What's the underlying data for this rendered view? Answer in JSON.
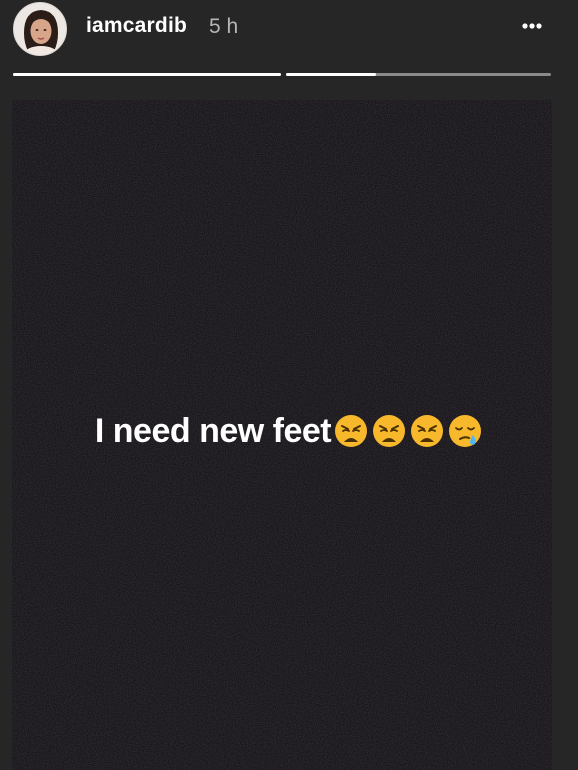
{
  "story": {
    "username": "iamcardib",
    "timestamp": "5 h",
    "caption_text": "I need new feet",
    "caption_emojis": [
      "weary-face-emoji",
      "weary-face-emoji",
      "weary-face-emoji",
      "sleepy-face-emoji"
    ],
    "progress": [
      1.0,
      0.34
    ]
  },
  "icons": {
    "more": "more-options-icon",
    "avatar": "profile-avatar"
  },
  "colors": {
    "background": "#262626",
    "media": "#0c0b0c",
    "progress_active": "#ffffff",
    "progress_inactive": "#8a8a8a",
    "emoji": "#f7b92b"
  }
}
